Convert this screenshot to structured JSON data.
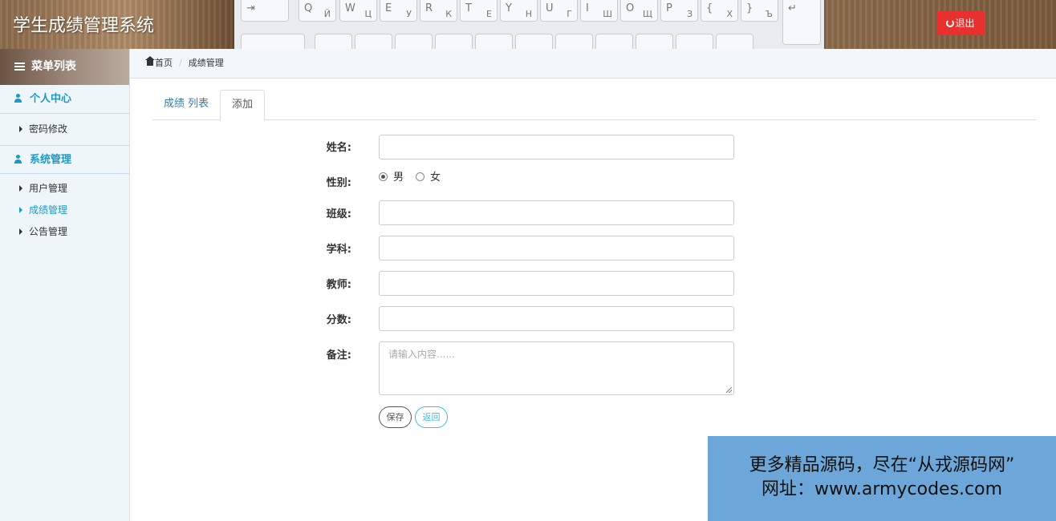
{
  "header": {
    "app_title": "学生成绩管理系统",
    "logout_label": "退出",
    "keyboard_keys": [
      {
        "top": "Q",
        "sub": "Й"
      },
      {
        "top": "W",
        "sub": "Ц"
      },
      {
        "top": "E",
        "sub": "У"
      },
      {
        "top": "R",
        "sub": "К"
      },
      {
        "top": "T",
        "sub": "Е"
      },
      {
        "top": "Y",
        "sub": "Н"
      },
      {
        "top": "U",
        "sub": "Г"
      },
      {
        "top": "I",
        "sub": "Ш"
      },
      {
        "top": "O",
        "sub": "Щ"
      },
      {
        "top": "P",
        "sub": "З"
      },
      {
        "top": "{",
        "sub": "Х"
      },
      {
        "top": "}",
        "sub": "Ъ"
      }
    ]
  },
  "sidebar": {
    "menu_title": "菜单列表",
    "groups": [
      {
        "label": "个人中心",
        "items": [
          {
            "label": "密码修改",
            "active": false
          }
        ]
      },
      {
        "label": "系统管理",
        "items": [
          {
            "label": "用户管理",
            "active": false
          },
          {
            "label": "成绩管理",
            "active": true
          },
          {
            "label": "公告管理",
            "active": false
          }
        ]
      }
    ]
  },
  "breadcrumb": {
    "home": "首页",
    "current": "成绩管理"
  },
  "tabs": [
    {
      "label": "成绩 列表",
      "active": false
    },
    {
      "label": "添加",
      "active": true
    }
  ],
  "form": {
    "name_label": "姓名:",
    "gender_label": "性别:",
    "gender_options": [
      {
        "label": "男",
        "checked": true
      },
      {
        "label": "女",
        "checked": false
      }
    ],
    "class_label": "班级:",
    "subject_label": "学科:",
    "teacher_label": "教师:",
    "score_label": "分数:",
    "remark_label": "备注:",
    "remark_placeholder": "请输入内容......",
    "save_label": "保存",
    "back_label": "返回"
  },
  "promo": {
    "line1": "更多精品源码，尽在“从戎源码网”",
    "line2": "网址：www.armycodes.com"
  },
  "colors": {
    "accent": "#1a9bc9",
    "logout": "#e8302f",
    "promo_bg": "#6da7d9"
  }
}
